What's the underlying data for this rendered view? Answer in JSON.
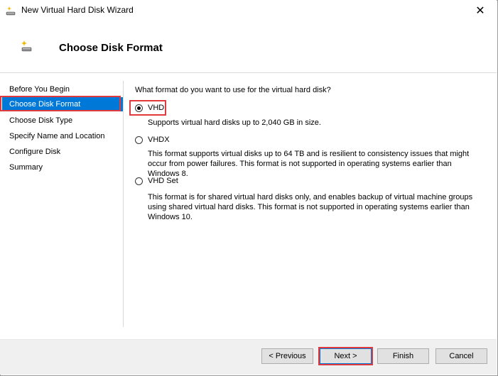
{
  "window": {
    "title": "New Virtual Hard Disk Wizard",
    "close_glyph": "✕"
  },
  "header": {
    "title": "Choose Disk Format"
  },
  "sidebar": {
    "items": [
      {
        "label": "Before You Begin",
        "active": false
      },
      {
        "label": "Choose Disk Format",
        "active": true
      },
      {
        "label": "Choose Disk Type",
        "active": false
      },
      {
        "label": "Specify Name and Location",
        "active": false
      },
      {
        "label": "Configure Disk",
        "active": false
      },
      {
        "label": "Summary",
        "active": false
      }
    ]
  },
  "main": {
    "question": "What format do you want to use for the virtual hard disk?",
    "options": [
      {
        "label": "VHD",
        "checked": true,
        "description": "Supports virtual hard disks up to 2,040 GB in size."
      },
      {
        "label": "VHDX",
        "checked": false,
        "description": "This format supports virtual disks up to 64 TB and is resilient to consistency issues that might occur from power failures. This format is not supported in operating systems earlier than Windows 8."
      },
      {
        "label": "VHD Set",
        "checked": false,
        "description": "This format is for shared virtual hard disks only, and enables backup of virtual machine groups using shared virtual hard disks. This format is not supported in operating systems earlier than Windows 10."
      }
    ]
  },
  "footer": {
    "previous_label": "< Previous",
    "next_label": "Next >",
    "finish_label": "Finish",
    "cancel_label": "Cancel"
  },
  "colors": {
    "selection": "#0078d7",
    "highlight_box": "#e0393e"
  },
  "icons": {
    "window": "disk-sparkle-icon",
    "header": "disk-sparkle-icon",
    "close": "close-icon"
  }
}
